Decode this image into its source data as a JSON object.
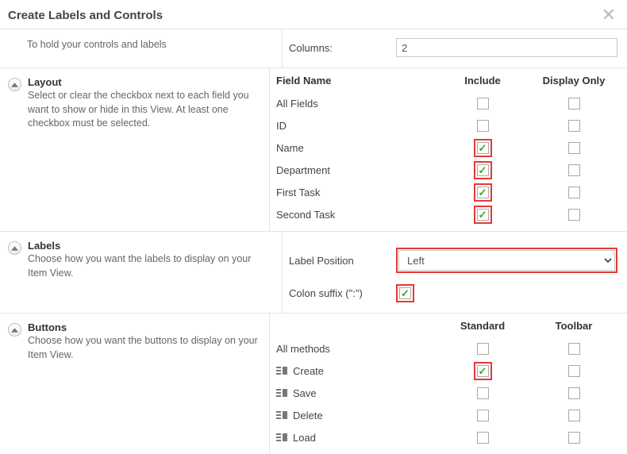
{
  "dialog": {
    "title": "Create Labels and Controls"
  },
  "top": {
    "desc": "To hold your controls and labels",
    "columns_label": "Columns:",
    "columns_value": "2"
  },
  "layout": {
    "title": "Layout",
    "desc": "Select or clear the checkbox next to each field you want to show or hide in this View. At least one checkbox must be selected.",
    "headers": {
      "field": "Field Name",
      "include": "Include",
      "display": "Display Only"
    },
    "rows": [
      {
        "label": "All Fields",
        "include": false,
        "display": false,
        "hl": false
      },
      {
        "label": "ID",
        "include": false,
        "display": false,
        "hl": false
      },
      {
        "label": "Name",
        "include": true,
        "display": false,
        "hl": true
      },
      {
        "label": "Department",
        "include": true,
        "display": false,
        "hl": true
      },
      {
        "label": "First Task",
        "include": true,
        "display": false,
        "hl": true
      },
      {
        "label": "Second Task",
        "include": true,
        "display": false,
        "hl": true
      }
    ]
  },
  "labels": {
    "title": "Labels",
    "desc": "Choose how you want the labels to display on your Item View.",
    "position_label": "Label Position",
    "position_value": "Left",
    "colon_label": "Colon suffix (\":\")",
    "colon_checked": true
  },
  "buttons": {
    "title": "Buttons",
    "desc": "Choose how you want the buttons to display on your Item View.",
    "headers": {
      "standard": "Standard",
      "toolbar": "Toolbar"
    },
    "rows": [
      {
        "label": "All methods",
        "icon": false,
        "standard": false,
        "toolbar": false,
        "hl": false
      },
      {
        "label": "Create",
        "icon": true,
        "standard": true,
        "toolbar": false,
        "hl": true
      },
      {
        "label": "Save",
        "icon": true,
        "standard": false,
        "toolbar": false,
        "hl": false
      },
      {
        "label": "Delete",
        "icon": true,
        "standard": false,
        "toolbar": false,
        "hl": false
      },
      {
        "label": "Load",
        "icon": true,
        "standard": false,
        "toolbar": false,
        "hl": false
      }
    ]
  }
}
